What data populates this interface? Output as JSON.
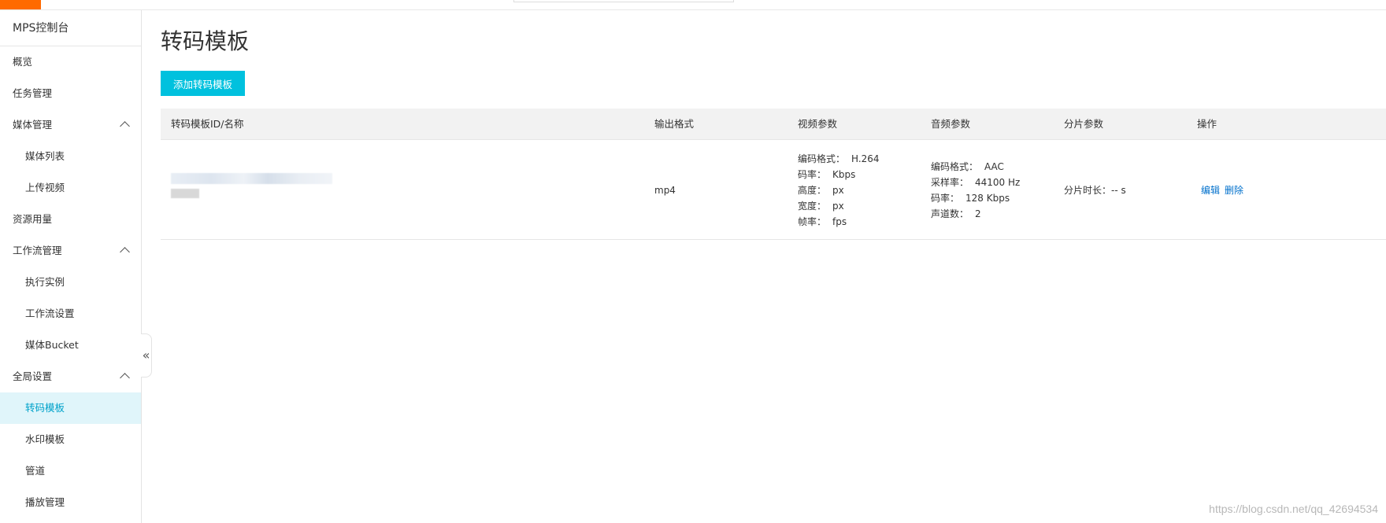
{
  "sidebar": {
    "title": "MPS控制台",
    "items": [
      {
        "label": "概览",
        "level": 1,
        "expandable": false,
        "active": false
      },
      {
        "label": "任务管理",
        "level": 1,
        "expandable": false,
        "active": false
      },
      {
        "label": "媒体管理",
        "level": 1,
        "expandable": true,
        "active": false
      },
      {
        "label": "媒体列表",
        "level": 2,
        "expandable": false,
        "active": false
      },
      {
        "label": "上传视频",
        "level": 2,
        "expandable": false,
        "active": false
      },
      {
        "label": "资源用量",
        "level": 1,
        "expandable": false,
        "active": false
      },
      {
        "label": "工作流管理",
        "level": 1,
        "expandable": true,
        "active": false
      },
      {
        "label": "执行实例",
        "level": 2,
        "expandable": false,
        "active": false
      },
      {
        "label": "工作流设置",
        "level": 2,
        "expandable": false,
        "active": false
      },
      {
        "label": "媒体Bucket",
        "level": 2,
        "expandable": false,
        "active": false
      },
      {
        "label": "全局设置",
        "level": 1,
        "expandable": true,
        "active": false
      },
      {
        "label": "转码模板",
        "level": 2,
        "expandable": false,
        "active": true
      },
      {
        "label": "水印模板",
        "level": 2,
        "expandable": false,
        "active": false
      },
      {
        "label": "管道",
        "level": 2,
        "expandable": false,
        "active": false
      },
      {
        "label": "播放管理",
        "level": 2,
        "expandable": false,
        "active": false
      }
    ],
    "collapse_glyph": "«"
  },
  "main": {
    "title": "转码模板",
    "add_button_label": "添加转码模板",
    "table": {
      "headers": [
        "转码模板ID/名称",
        "输出格式",
        "视频参数",
        "音频参数",
        "分片参数",
        "操作"
      ],
      "rows": [
        {
          "output_format": "mp4",
          "video_params": [
            {
              "label": "编码格式：",
              "value": "H.264"
            },
            {
              "label": "码率：",
              "value": "Kbps"
            },
            {
              "label": "高度：",
              "value": "px"
            },
            {
              "label": "宽度：",
              "value": "px"
            },
            {
              "label": "帧率：",
              "value": "fps"
            }
          ],
          "audio_params": [
            {
              "label": "编码格式：",
              "value": "AAC"
            },
            {
              "label": "采样率：",
              "value": "44100 Hz"
            },
            {
              "label": "码率：",
              "value": "128 Kbps"
            },
            {
              "label": "声道数：",
              "value": "2"
            }
          ],
          "segment_params": "分片时长：-- s",
          "actions": {
            "edit": "编辑",
            "delete": "删除"
          }
        }
      ]
    }
  },
  "watermark": "https://blog.csdn.net/qq_42694534",
  "colors": {
    "accent": "#00c1de",
    "active_bg": "#e0f5fa",
    "active_text": "#00a2ca",
    "link": "#0070cc",
    "brand": "#ff6a00"
  }
}
